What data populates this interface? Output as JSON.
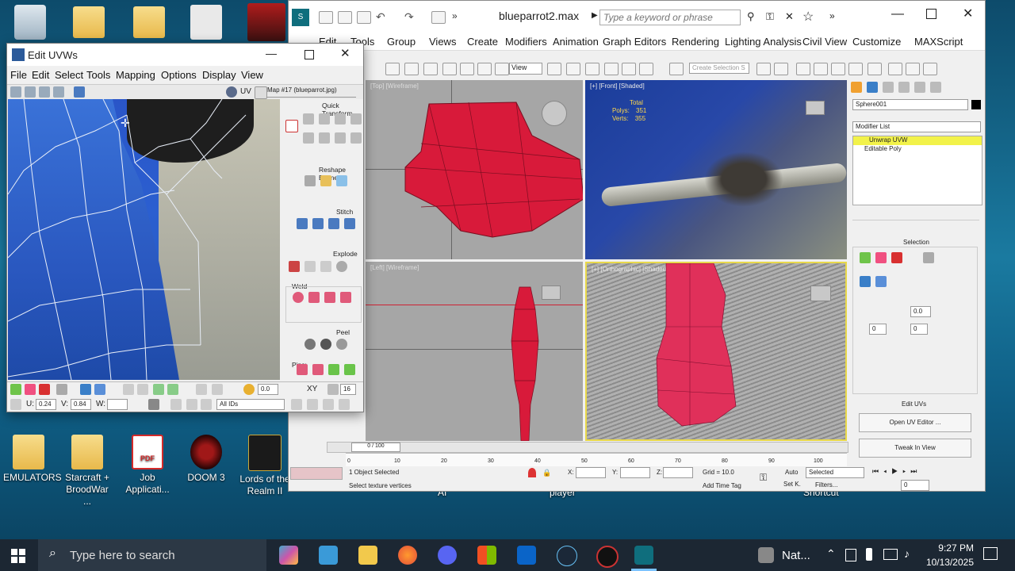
{
  "desktop": {
    "icons": [
      {
        "label": "EMULATORS"
      },
      {
        "label": "Starcraft + BroodWar ..."
      },
      {
        "label": "Job Applicati..."
      },
      {
        "label": "DOOM 3"
      },
      {
        "label": "Lords of the Realm II"
      }
    ],
    "bg_labels": {
      "ai": "AI",
      "player": "player",
      "shortcut": "Shortcut"
    }
  },
  "max": {
    "title": "blueparrot2.max",
    "search_placeholder": "Type a keyword or phrase",
    "menus": [
      "Edit",
      "Tools",
      "Group",
      "Views",
      "Create",
      "Modifiers",
      "Animation",
      "Graph Editors",
      "Rendering",
      "Lighting Analysis",
      "Civil View",
      "Customize",
      "MAXScript"
    ],
    "view_dropdown": "View",
    "selection_set_placeholder": "Create Selection S",
    "viewports": {
      "top_left_label": "[Top] [Wireframe]",
      "front_label": "[+] [Front] [Shaded]",
      "left_label": "[Left] [Wireframe]",
      "persp_label": "[+] [Orthographic] [Shaded]",
      "stats": {
        "total": "Total",
        "polys_label": "Polys:",
        "polys": "351",
        "verts_label": "Verts:",
        "verts": "355"
      }
    },
    "command_panel": {
      "object_name": "Sphere001",
      "modifier_list": "Modifier List",
      "stack": [
        "Unwrap UVW",
        "Editable Poly"
      ],
      "selection_title": "Selection",
      "spinner_a": "0.0",
      "spinner_b": "0",
      "spinner_c": "0",
      "edit_uvs_title": "Edit UVs",
      "open_uv_editor": "Open UV Editor ...",
      "tweak_in_view": "Tweak In View"
    },
    "timeline": {
      "frame": "0 / 100",
      "ticks": [
        "0",
        "10",
        "20",
        "30",
        "40",
        "50",
        "60",
        "70",
        "80",
        "90",
        "100"
      ]
    },
    "status": {
      "objects": "1 Object Selected",
      "prompt": "Select texture vertices",
      "x_label": "X:",
      "y_label": "Y:",
      "z_label": "Z:",
      "grid": "Grid = 10.0",
      "add_time_tag": "Add Time Tag",
      "auto": "Auto",
      "set_k": "Set K.",
      "selected": "Selected",
      "filters": "Filters...",
      "frame_field": "0"
    }
  },
  "uvw": {
    "title": "Edit UVWs",
    "menus": [
      "File",
      "Edit",
      "Select",
      "Tools",
      "Mapping",
      "Options",
      "Display",
      "View"
    ],
    "uv_label": "UV",
    "map_dropdown": "Map #17 (blueparrot.jpg)",
    "rollouts": [
      "Quick Transform",
      "Reshape Elements",
      "Stitch",
      "Explode",
      "Weld",
      "Peel",
      "Pins:"
    ],
    "bottom": {
      "angle": "0.0",
      "xy": "XY",
      "count": "16",
      "u_label": "U:",
      "u_value": "0.24",
      "v_label": "V:",
      "v_value": "0.84",
      "w_label": "W:",
      "w_value": "",
      "ids": "All IDs"
    }
  },
  "taskbar": {
    "search_placeholder": "Type here to search",
    "tray_app": "Nat...",
    "time": "9:27 PM",
    "date": "10/13/2025"
  }
}
